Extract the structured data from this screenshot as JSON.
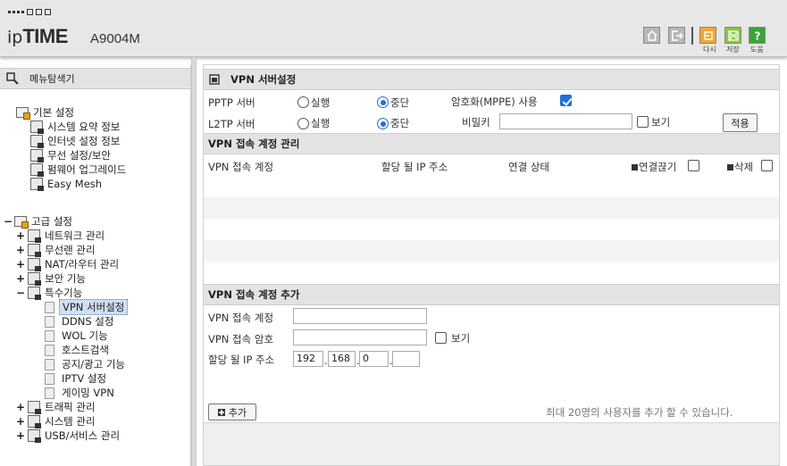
{
  "header": {
    "brand_ip": "ip",
    "brand_time": "TIME",
    "model": "A9004M",
    "buttons": {
      "reset": "다시",
      "save": "저장",
      "help": "도움"
    }
  },
  "menu": {
    "title": "메뉴탐색기",
    "basic": {
      "label": "기본 설정",
      "items": [
        "시스템 요약 정보",
        "인터넷 설정 정보",
        "무선 설정/보안",
        "펌웨어 업그레이드",
        "Easy Mesh"
      ]
    },
    "advanced": {
      "label": "고급 설정",
      "items": [
        "네트워크 관리",
        "무선랜 관리",
        "NAT/라우터 관리",
        "보안 기능",
        "특수기능"
      ],
      "special": [
        "VPN 서버설정",
        "DDNS 설정",
        "WOL 기능",
        "호스트검색",
        "공지/광고 기능",
        "IPTV 설정",
        "게이밍 VPN"
      ],
      "after": [
        "트래픽 관리",
        "시스템 관리",
        "USB/서비스 관리"
      ]
    }
  },
  "vpn": {
    "title": "VPN 서버설정",
    "pptp_label": "PPTP 서버",
    "l2tp_label": "L2TP 서버",
    "run_label": "실행",
    "stop_label": "중단",
    "mppe_label": "암호화(MPPE) 사용",
    "secret_label": "비밀키",
    "secret_value": "",
    "show_label": "보기",
    "apply_label": "적용",
    "pptp_state": "stop",
    "l2tp_state": "stop",
    "mppe_checked": true
  },
  "accounts": {
    "title": "VPN 접속 계정 관리",
    "columns": {
      "account": "VPN 접속 계정",
      "ip": "할당 될 IP 주소",
      "status": "연결 상태",
      "disconnect": "연결끊기",
      "delete": "삭제"
    },
    "rows": []
  },
  "add": {
    "title": "VPN 접속 계정 추가",
    "account_label": "VPN 접속 계정",
    "account_value": "",
    "password_label": "VPN 접속 암호",
    "password_value": "",
    "show_label": "보기",
    "ip_label": "할당 될 IP 주소",
    "ip": [
      "192",
      "168",
      "0",
      ""
    ],
    "add_label": "추가",
    "note": "최대 20명의 사용자를 추가 할 수 있습니다."
  },
  "colors": {
    "accent_blue": "#1e6fd9",
    "header_bg": "#e7e7e7",
    "section_bg": "#e3e3e3",
    "save_green": "#8cc63f",
    "reset_orange": "#f0a830",
    "help_green": "#3aa53a"
  }
}
